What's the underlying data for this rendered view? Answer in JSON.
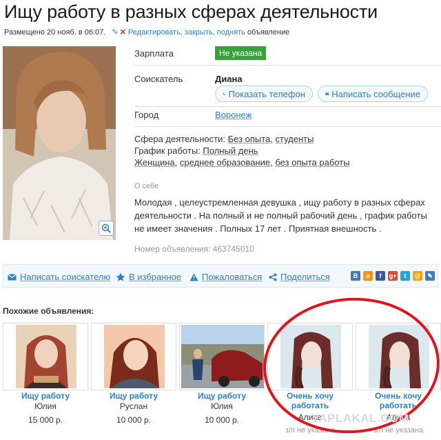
{
  "ad": {
    "title": "Ищу работу в разных сферах деятельности",
    "posted": "Размещено 20 нояб. в 06:07.",
    "edit_link": "Редактировать, закрыть, поднять",
    "edit_suffix": " объявление"
  },
  "fields": {
    "salary_label": "Зарплата",
    "salary_value": "Не указана",
    "applicant_label": "Соискатель",
    "applicant_name": "Диана",
    "show_phone": "Показать телефон",
    "write_message": "Написать сообщение",
    "city_label": "Город",
    "city_value": "Воронеж"
  },
  "details": {
    "sphere_label": "Сфера деятельности:",
    "sphere_value1": "Без опыта",
    "sphere_value2": "студенты",
    "schedule_label": "График работы:",
    "schedule_value": "Полный день",
    "gender": "Женщина",
    "education": "среднее образование",
    "experience": "без опыта работы"
  },
  "about": {
    "label": "О себе",
    "text": "Молодая , целеустремленная девушка , ищу работу в разных сферах деятельности . На полный и не полный рабочий день , график работы не имеет значения . Полных 17 лет . Приятная внешность ."
  },
  "ad_number": "Номер объявления: 463745010",
  "actions": {
    "write": "Написать соискателю",
    "favorite": "В избранное",
    "complain": "Пожаловаться",
    "share": "Поделиться"
  },
  "social": [
    {
      "name": "vk-icon",
      "glyph": "B",
      "color": "#4a76a8"
    },
    {
      "name": "odnoklassniki-icon",
      "glyph": "o",
      "color": "#f7931e"
    },
    {
      "name": "facebook-icon",
      "glyph": "f",
      "color": "#3b5998"
    },
    {
      "name": "google-plus-icon",
      "glyph": "g+",
      "color": "#dd4b39"
    },
    {
      "name": "twitter-icon",
      "glyph": "t",
      "color": "#2ba3d6"
    },
    {
      "name": "mail-ru-icon",
      "glyph": "@",
      "color": "#f2a315"
    },
    {
      "name": "livejournal-icon",
      "glyph": "✎",
      "color": "#4a7ab3"
    }
  ],
  "similar": {
    "heading": "Похожие объявления:",
    "items": [
      {
        "title": "Ищу работу",
        "name": "Юлия",
        "price": "15 000 р."
      },
      {
        "title": "Ищу работу",
        "name": "Руслан",
        "price": "10 000 р."
      },
      {
        "title": "Ищу работу",
        "name": "Юлия",
        "price": "10 000 р."
      },
      {
        "title": "Очень хочу работать",
        "name": "Алиса",
        "price": "з/п не указана"
      },
      {
        "title": "Очень хочу работать",
        "name": "Алиса",
        "price": "з/п не указана"
      }
    ]
  },
  "watermark": "YAPLAKAL.COM"
}
